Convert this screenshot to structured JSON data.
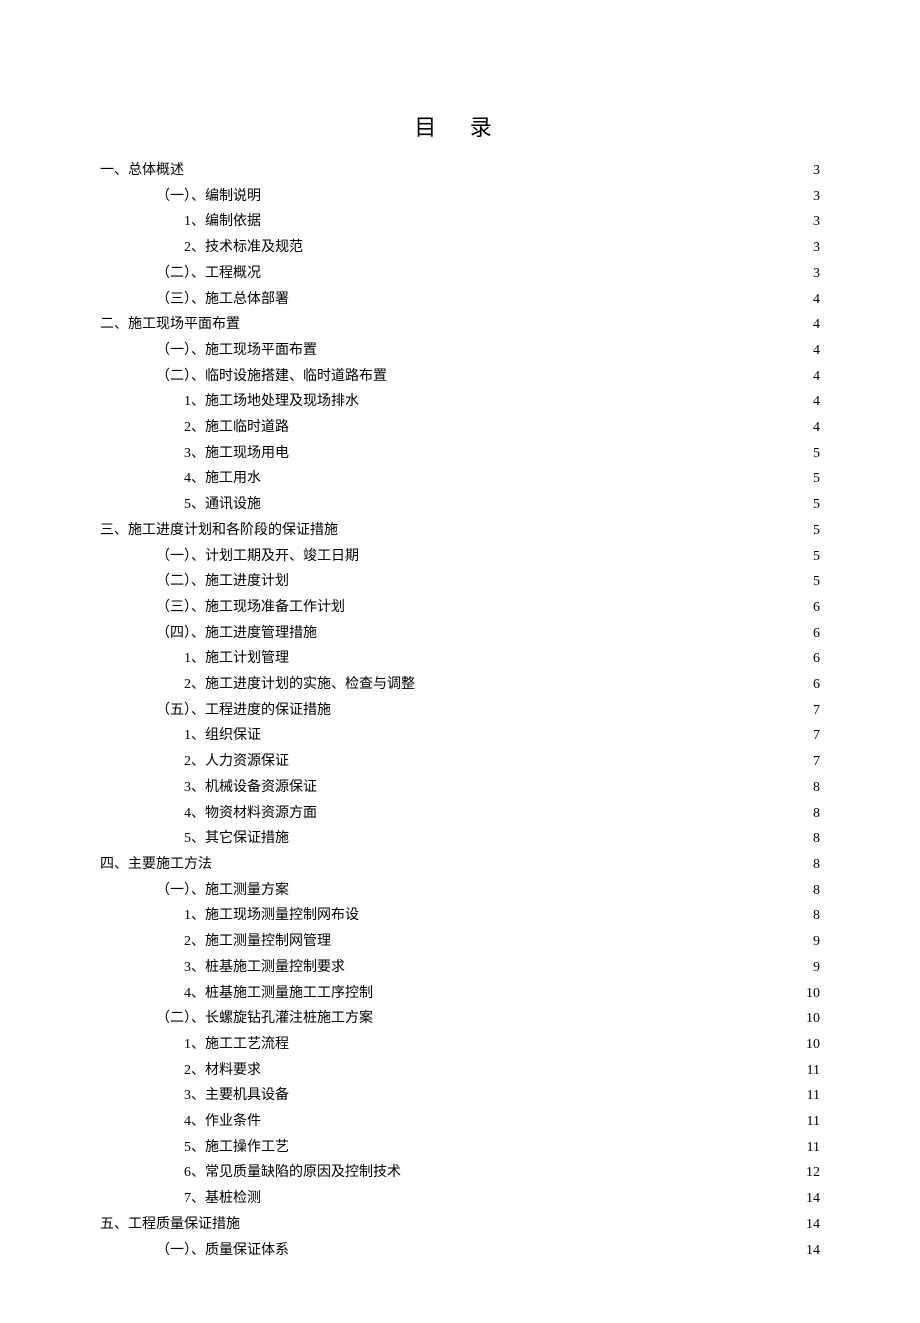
{
  "title": "目 录",
  "entries": [
    {
      "level": 1,
      "label": "一、总体概述",
      "page": "3"
    },
    {
      "level": 2,
      "label": "（一）、编制说明",
      "page": "3"
    },
    {
      "level": 3,
      "label": "1、编制依据",
      "page": "3"
    },
    {
      "level": 3,
      "label": "2、技术标准及规范",
      "page": "3"
    },
    {
      "level": 2,
      "label": "（二）、工程概况",
      "page": "3"
    },
    {
      "level": 2,
      "label": "（三）、施工总体部署",
      "page": "4"
    },
    {
      "level": 1,
      "label": "二、施工现场平面布置",
      "page": "4"
    },
    {
      "level": 2,
      "label": "（一）、施工现场平面布置",
      "page": "4"
    },
    {
      "level": 2,
      "label": "（二）、临时设施搭建、临时道路布置",
      "page": "4"
    },
    {
      "level": 3,
      "label": "1、施工场地处理及现场排水",
      "page": "4"
    },
    {
      "level": 3,
      "label": "2、施工临时道路",
      "page": "4"
    },
    {
      "level": 3,
      "label": "3、施工现场用电",
      "page": "5"
    },
    {
      "level": 3,
      "label": "4、施工用水",
      "page": "5"
    },
    {
      "level": 3,
      "label": "5、通讯设施",
      "page": "5"
    },
    {
      "level": 1,
      "label": "三、施工进度计划和各阶段的保证措施",
      "page": "5"
    },
    {
      "level": 2,
      "label": "（一）、计划工期及开、竣工日期",
      "page": "5"
    },
    {
      "level": 2,
      "label": "（二）、施工进度计划",
      "page": "5"
    },
    {
      "level": 2,
      "label": "（三）、施工现场准备工作计划",
      "page": "6"
    },
    {
      "level": 2,
      "label": "（四）、施工进度管理措施",
      "page": "6"
    },
    {
      "level": 3,
      "label": "1、施工计划管理",
      "page": "6"
    },
    {
      "level": 3,
      "label": "2、施工进度计划的实施、检查与调整",
      "page": "6"
    },
    {
      "level": 2,
      "label": "（五）、工程进度的保证措施",
      "page": "7"
    },
    {
      "level": 3,
      "label": "1、组织保证",
      "page": "7"
    },
    {
      "level": 3,
      "label": "2、人力资源保证",
      "page": "7"
    },
    {
      "level": 3,
      "label": "3、机械设备资源保证",
      "page": "8"
    },
    {
      "level": 3,
      "label": "4、物资材料资源方面",
      "page": "8"
    },
    {
      "level": 3,
      "label": "5、其它保证措施",
      "page": "8"
    },
    {
      "level": 1,
      "label": "四、主要施工方法",
      "page": "8"
    },
    {
      "level": 2,
      "label": "（一）、施工测量方案",
      "page": "8"
    },
    {
      "level": 3,
      "label": "1、施工现场测量控制网布设",
      "page": "8"
    },
    {
      "level": 3,
      "label": "2、施工测量控制网管理",
      "page": "9"
    },
    {
      "level": 3,
      "label": "3、桩基施工测量控制要求",
      "page": "9"
    },
    {
      "level": 3,
      "label": "4、桩基施工测量施工工序控制",
      "page": "10"
    },
    {
      "level": 2,
      "label": "（二）、长螺旋钻孔灌注桩施工方案",
      "page": "10"
    },
    {
      "level": 3,
      "label": "1、施工工艺流程",
      "page": "10"
    },
    {
      "level": 3,
      "label": "2、材料要求",
      "page": "11"
    },
    {
      "level": 3,
      "label": "3、主要机具设备",
      "page": "11"
    },
    {
      "level": 3,
      "label": "4、作业条件",
      "page": "11"
    },
    {
      "level": 3,
      "label": "5、施工操作工艺",
      "page": "11"
    },
    {
      "level": 3,
      "label": "6、常见质量缺陷的原因及控制技术",
      "page": "12"
    },
    {
      "level": 3,
      "label": "7、基桩检测",
      "page": "14"
    },
    {
      "level": 1,
      "label": "五、工程质量保证措施",
      "page": "14"
    },
    {
      "level": 2,
      "label": "（一）、质量保证体系",
      "page": "14"
    }
  ]
}
